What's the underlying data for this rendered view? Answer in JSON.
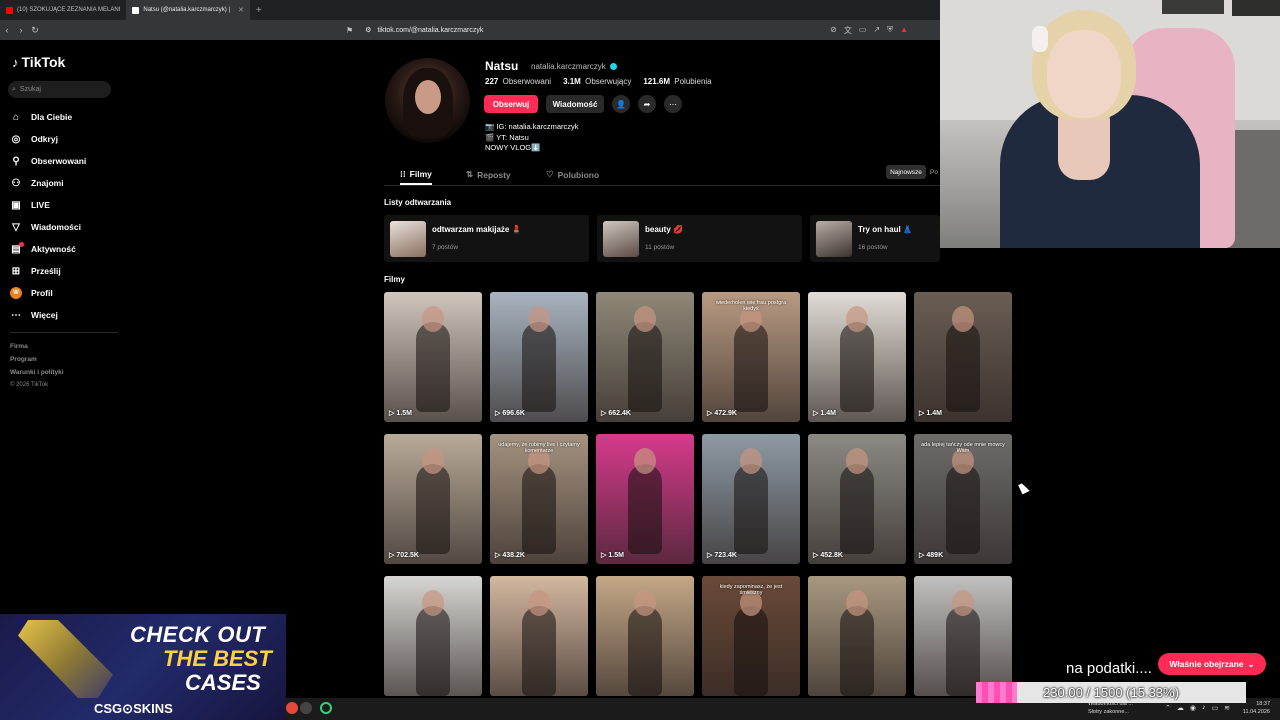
{
  "browser": {
    "tabs": [
      {
        "title": "(10) SZOKUJĄCE ZEZNANIA MELANI",
        "active": false,
        "favicon_color": "#ff0000"
      },
      {
        "title": "Natsu (@natalia.karczmarczyk) |",
        "active": true,
        "favicon_color": "#ffffff"
      }
    ],
    "new_tab_icon": "plus-icon",
    "address": "tiktok.com/@natalia.karczmarczyk"
  },
  "sidebar": {
    "brand": "TikTok",
    "search_placeholder": "Szukaj",
    "items": [
      {
        "label": "Dla Ciebie",
        "icon": "home-icon"
      },
      {
        "label": "Odkryj",
        "icon": "compass-icon"
      },
      {
        "label": "Obserwowani",
        "icon": "following-icon"
      },
      {
        "label": "Znajomi",
        "icon": "friends-icon"
      },
      {
        "label": "LIVE",
        "icon": "live-icon"
      },
      {
        "label": "Wiadomości",
        "icon": "messages-icon"
      },
      {
        "label": "Aktywność",
        "icon": "activity-icon"
      },
      {
        "label": "Prześlij",
        "icon": "upload-icon"
      },
      {
        "label": "Profil",
        "icon": "avatar-icon"
      },
      {
        "label": "Więcej",
        "icon": "more-icon"
      }
    ],
    "footer_links": [
      "Firma",
      "Program",
      "Warunki i polityki"
    ],
    "copyright": "© 2026 TikTok"
  },
  "profile": {
    "name": "Natsu",
    "username": "natalia.karczmarczyk",
    "following_count": "227",
    "following_label": "Obserwowani",
    "followers_count": "3.1M",
    "followers_label": "Obserwujący",
    "likes_count": "121.6M",
    "likes_label": "Polubienia",
    "follow_button": "Obserwuj",
    "message_button": "Wiadomość",
    "bio": [
      "IG: natalia.karczmarczyk",
      "YT: Natsu",
      "NOWY VLOG⬇️"
    ]
  },
  "tabs": [
    {
      "label": "Filmy",
      "active": true
    },
    {
      "label": "Reposty",
      "active": false
    },
    {
      "label": "Polubiono",
      "active": false
    }
  ],
  "sort": {
    "active": "Najnowsze",
    "next": "Po"
  },
  "playlists_heading": "Listy odtwarzania",
  "playlists": [
    {
      "title": "odtwarzam makijaże 💄",
      "count": "7 postów"
    },
    {
      "title": "beauty 💋",
      "count": "11 postów"
    },
    {
      "title": "Try on haul 👗",
      "count": "16 postów"
    }
  ],
  "videos_heading": "Filmy",
  "videos": [
    {
      "views": "1.5M",
      "color": "#cfc6bc",
      "caption": ""
    },
    {
      "views": "696.6K",
      "color": "#a8b4c0",
      "caption": ""
    },
    {
      "views": "662.4K",
      "color": "#8e8878",
      "caption": ""
    },
    {
      "views": "472.9K",
      "color": "#b89a82",
      "caption": "wiederholen wie frau postgra kiedyś"
    },
    {
      "views": "1.4M",
      "color": "#e2dcd6",
      "caption": ""
    },
    {
      "views": "1.4M",
      "color": "#6a5e54",
      "caption": ""
    },
    {
      "views": "702.5K",
      "color": "#b8aa98",
      "caption": ""
    },
    {
      "views": "438.2K",
      "color": "#a59380",
      "caption": "udajemy, że robimy live i czytamy komentarze"
    },
    {
      "views": "1.5M",
      "color": "#d63a8c",
      "caption": ""
    },
    {
      "views": "723.4K",
      "color": "#8e9aa4",
      "caption": ""
    },
    {
      "views": "452.8K",
      "color": "#8c8a84",
      "caption": ""
    },
    {
      "views": "489K",
      "color": "#6e6c6a",
      "caption": "ada lepiej tańczy ode mnie mowcy Wam"
    },
    {
      "views": "",
      "color": "#d8d6d2",
      "caption": ""
    },
    {
      "views": "",
      "color": "#d4b8a0",
      "caption": ""
    },
    {
      "views": "",
      "color": "#c4a888",
      "caption": ""
    },
    {
      "views": "",
      "color": "#6a4a38",
      "caption": "kiedy zapominasz, że jest śmieszny"
    },
    {
      "views": "",
      "color": "#a89880",
      "caption": ""
    },
    {
      "views": "",
      "color": "#c2c0be",
      "caption": ""
    }
  ],
  "ad": {
    "line1": "CHECK OUT",
    "line2": "THE BEST",
    "line3": "CASES",
    "brand": "CSG⊙SKINS"
  },
  "overlay": {
    "chat_text": "na podatki....",
    "just_watched_button": "Właśnie obejrzane",
    "goal_text": "230.00 / 1500 (15.33%)",
    "goal_fraction": 0.1533
  },
  "taskbar": {
    "notification_title": "Wiadomości dla ...",
    "notification_subtitle": "Słotry zakonne...",
    "time": "18:37",
    "date": "11.04.2026"
  }
}
